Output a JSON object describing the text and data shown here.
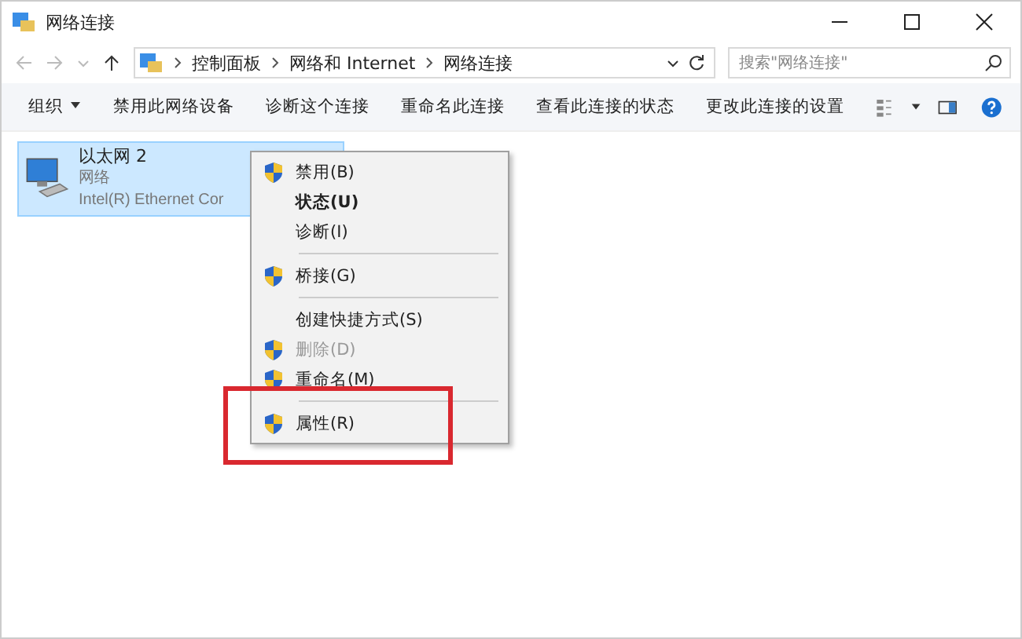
{
  "window": {
    "title": "网络连接"
  },
  "address": {
    "crumbs": [
      "控制面板",
      "网络和 Internet",
      "网络连接"
    ]
  },
  "search": {
    "placeholder": "搜索\"网络连接\""
  },
  "toolbar": [
    {
      "label": "组织",
      "dropdown": true
    },
    {
      "label": "禁用此网络设备",
      "dropdown": false
    },
    {
      "label": "诊断这个连接",
      "dropdown": false
    },
    {
      "label": "重命名此连接",
      "dropdown": false
    },
    {
      "label": "查看此连接的状态",
      "dropdown": false
    },
    {
      "label": "更改此连接的设置",
      "dropdown": false
    }
  ],
  "connections": [
    {
      "name": "以太网 2",
      "status": "网络",
      "device": "Intel(R) Ethernet Cor",
      "selected": true
    }
  ],
  "context_menu": [
    {
      "kind": "item",
      "label": "禁用(B)",
      "shield": true,
      "bold": false,
      "disabled": false
    },
    {
      "kind": "item",
      "label": "状态(U)",
      "shield": false,
      "bold": true,
      "disabled": false
    },
    {
      "kind": "item",
      "label": "诊断(I)",
      "shield": false,
      "bold": false,
      "disabled": false
    },
    {
      "kind": "separator"
    },
    {
      "kind": "item",
      "label": "桥接(G)",
      "shield": true,
      "bold": false,
      "disabled": false
    },
    {
      "kind": "separator"
    },
    {
      "kind": "item",
      "label": "创建快捷方式(S)",
      "shield": false,
      "bold": false,
      "disabled": false
    },
    {
      "kind": "item",
      "label": "删除(D)",
      "shield": true,
      "bold": false,
      "disabled": true
    },
    {
      "kind": "item",
      "label": "重命名(M)",
      "shield": true,
      "bold": false,
      "disabled": false
    },
    {
      "kind": "separator"
    },
    {
      "kind": "item",
      "label": "属性(R)",
      "shield": true,
      "bold": false,
      "disabled": false
    }
  ]
}
